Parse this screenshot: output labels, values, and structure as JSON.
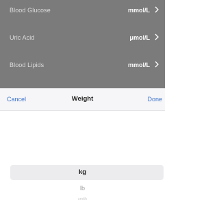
{
  "list": {
    "items": [
      {
        "label": "Blood Glucose",
        "unit": "mmol/L",
        "chevron": "chevron-right-icon"
      },
      {
        "label": "Uric Acid",
        "unit": "μmol/L",
        "chevron": "chevron-right-icon"
      },
      {
        "label": "Blood Lipids",
        "unit": "mmol/L",
        "chevron": "chevron-right-icon"
      }
    ]
  },
  "sheet": {
    "cancel_label": "Cancel",
    "title": "Weight",
    "done_label": "Done"
  },
  "picker": {
    "options": [
      "kg",
      "lb",
      "smith"
    ],
    "selected": "kg"
  },
  "colors": {
    "overlay": "#7b7b7b",
    "accent": "#3e74c9",
    "header_bg": "#f6f6f8",
    "selection_bg": "#ececee"
  }
}
